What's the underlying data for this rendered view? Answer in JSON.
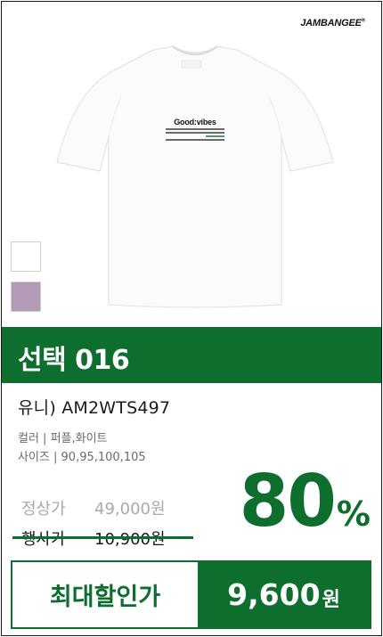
{
  "brand": {
    "name": "JAMBANGEE",
    "mark": "®"
  },
  "product": {
    "print_text": "Good:vibes",
    "swatches": [
      {
        "name": "white",
        "color": "#ffffff"
      },
      {
        "name": "purple",
        "color": "#b39ab8"
      }
    ]
  },
  "banner": {
    "title": "선택 016"
  },
  "details": {
    "model": "유니) AM2WTS497",
    "color_line": "컬러 | 퍼플,화이트",
    "size_line": "사이즈 | 90,95,100,105"
  },
  "pricing": {
    "regular_label": "정상가",
    "regular_price": "49,000원",
    "event_label": "행사가",
    "event_price": "10,900원",
    "discount_number": "80",
    "discount_unit": "%",
    "final_label": "최대할인가",
    "final_amount": "9,600",
    "final_unit": "원"
  },
  "colors": {
    "accent": "#0d6e2e"
  }
}
